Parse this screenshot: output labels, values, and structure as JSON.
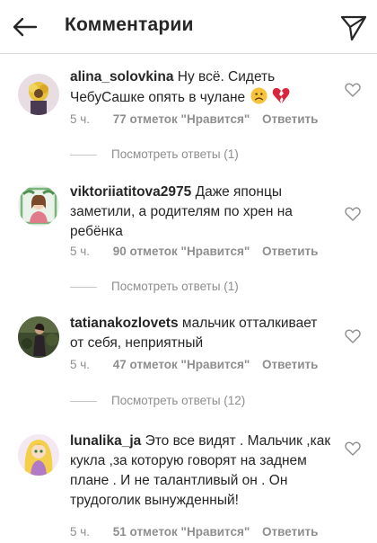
{
  "header": {
    "title": "Комментарии",
    "back_icon": "arrow-left-icon",
    "send_icon": "paper-plane-icon"
  },
  "comments": [
    {
      "username": "alina_solovkina",
      "text": "Ну всё. Сидеть ЧебуСашке опять в чулане",
      "emojis": [
        "frowning-face",
        "broken-heart"
      ],
      "time": "5 ч.",
      "likes": "77 отметок \"Нравится\"",
      "reply": "Ответить",
      "view_replies": "Посмотреть ответы (1)"
    },
    {
      "username": "viktoriiatitova2975",
      "text": "Даже японцы заметили, а родителям по хрен на ребёнка",
      "time": "5 ч.",
      "likes": "90 отметок \"Нравится\"",
      "reply": "Ответить",
      "view_replies": "Посмотреть ответы (1)"
    },
    {
      "username": "tatianakozlovets",
      "text": "мальчик отталкивает от себя, неприятный",
      "time": "5 ч.",
      "likes": "47 отметок \"Нравится\"",
      "reply": "Ответить",
      "view_replies": "Посмотреть ответы (12)"
    },
    {
      "username": "lunalika_ja",
      "text": "Это все видят . Мальчик ,как кукла ,за которую говорят на заднем плане . И не талантливый он . Он трудоголик вынужденный!",
      "time": "5 ч.",
      "likes": "51 отметок \"Нравится\"",
      "reply": "Ответить"
    }
  ],
  "colors": {
    "text": "#262626",
    "secondary": "#8e8e8e",
    "divider": "#dbdbdb"
  }
}
